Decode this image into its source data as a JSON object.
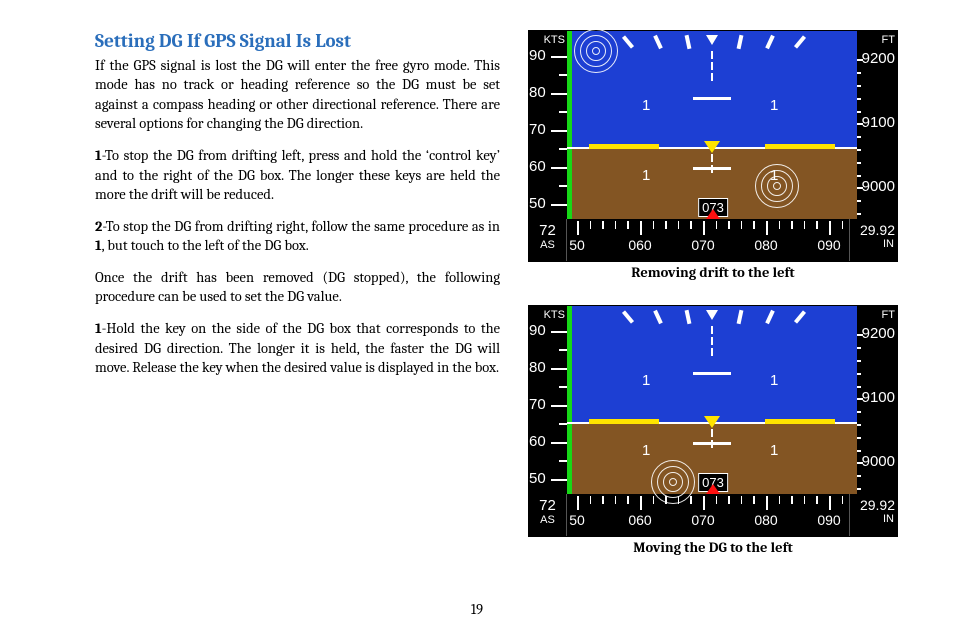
{
  "heading": "Setting DG If GPS Signal Is Lost",
  "p1": "If the GPS signal is lost the DG will enter the free gyro mode.  This mode has no track or heading reference so the DG must be set against a compass heading or other directional reference.  There are several options for changing the DG direction.",
  "p2_num": "1",
  "p2": "-To stop the DG from drifting left, press and hold the ‘control key’ and to the right of the DG box.  The longer these keys are held the more the drift will be reduced.",
  "p3_num": "2",
  "p3": "-To stop the DG from drifting right, follow the same procedure as in ",
  "p3b": "1",
  "p3c": ", but touch to the left of the DG box.",
  "p4": "Once the drift has been removed (DG stopped), the following procedure can be used to set the DG value.",
  "p5_num": "1",
  "p5": "-Hold the key on the side of the DG box that corresponds to the desired DG direction.   The longer it is held, the faster the DG will move.  Release the key when the desired value is displayed in the box.",
  "pagenum": "19",
  "cap1": "Removing drift to the left",
  "cap2": "Moving the DG to the left",
  "pfd": {
    "kts_label": "KTS",
    "ft_label": "FT",
    "as_tape": [
      "90",
      "80",
      "70",
      "60",
      "50"
    ],
    "alt_tape": [
      "9200",
      "9100",
      "9000"
    ],
    "as_box": "72",
    "as_unit": "AS",
    "baro": "29.92",
    "baro_unit": "IN",
    "dg_box": "073",
    "dg_scale": [
      "50",
      "060",
      "070",
      "080",
      "090"
    ],
    "pitch_label": "1"
  }
}
